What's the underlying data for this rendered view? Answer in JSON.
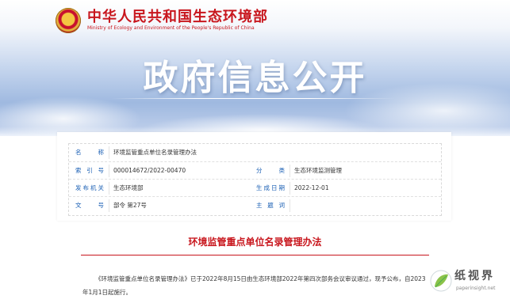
{
  "header": {
    "ministry_cn": "中华人民共和国生态环境部",
    "ministry_en": "Ministry of Ecology and Environment of the People's Republic of China",
    "emblem": "national-emblem"
  },
  "banner": {
    "title": "政府信息公开"
  },
  "info": {
    "name_label": "名 称",
    "name_value": "环境监管重点单位名录管理办法",
    "index_label": "索 引 号",
    "index_value": "000014672/2022-00470",
    "category_label": "分 类",
    "category_value": "生态环境监测管理",
    "publisher_label": "发布机关",
    "publisher_value": "生态环境部",
    "date_label": "生成日期",
    "date_value": "2022-12-01",
    "docno_label": "文 号",
    "docno_value": "部令 第27号",
    "keywords_label": "主 题 词",
    "keywords_value": ""
  },
  "content": {
    "title": "环境监管重点单位名录管理办法",
    "paragraph": "《环境监管重点单位名录管理办法》已于2022年8月15日由生态环境部2022年第四次部务会议审议通过，现予公布，自2023年1月1日起施行。"
  },
  "watermark": {
    "text": "纸视界",
    "url": "paperinsight.net",
    "icon": "leaf-icon"
  },
  "colors": {
    "brand_red": "#c8161d",
    "label_blue": "#1a5fb4",
    "text_gray": "#333333"
  }
}
